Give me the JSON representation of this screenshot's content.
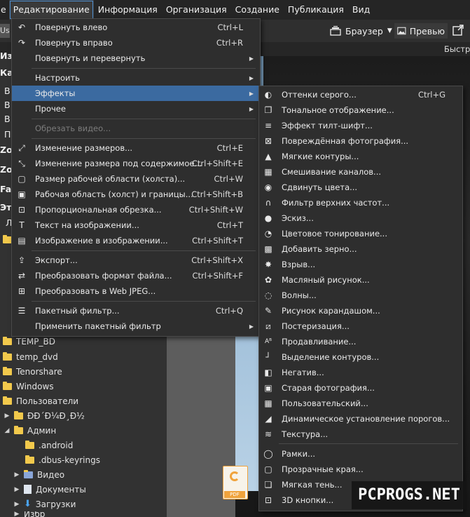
{
  "menubar": {
    "items": [
      {
        "label": "е"
      },
      {
        "label": "Редактирование"
      },
      {
        "label": "Информация"
      },
      {
        "label": "Организация"
      },
      {
        "label": "Создание"
      },
      {
        "label": "Публикация"
      },
      {
        "label": "Вид"
      }
    ]
  },
  "toolbar": {
    "user_tab": "Use",
    "browser_label": "Браузер",
    "preview_label": "Превью",
    "fast_label": "Быстр"
  },
  "sidebar": {
    "fragments": [
      "Из",
      "Ка",
      "В",
      "В",
      "В",
      "П",
      "Zo",
      "Zo",
      "Fac",
      "Эт",
      "Л"
    ],
    "items": [
      {
        "label": "TEMP_BD"
      },
      {
        "label": "temp_dvd"
      },
      {
        "label": "Tenorshare"
      },
      {
        "label": "Windows"
      },
      {
        "label": "Пользователи"
      },
      {
        "label": "ÐÐ´Ð¼Ð¸Ð½"
      },
      {
        "label": "Админ"
      },
      {
        "label": ".android"
      },
      {
        "label": ".dbus-keyrings"
      },
      {
        "label": "Видео"
      },
      {
        "label": "Документы"
      },
      {
        "label": "Загрузки"
      },
      {
        "label": "Избр"
      }
    ]
  },
  "edit_menu": {
    "items": [
      {
        "label": "Повернуть влево",
        "shortcut": "Ctrl+L",
        "icon": "rotate-left-icon"
      },
      {
        "label": "Повернуть вправо",
        "shortcut": "Ctrl+R",
        "icon": "rotate-right-icon"
      },
      {
        "label": "Повернуть и перевернуть",
        "shortcut": "",
        "submenu": true
      },
      {
        "label": "Настроить",
        "shortcut": "",
        "submenu": true
      },
      {
        "label": "Эффекты",
        "shortcut": "",
        "submenu": true,
        "highlighted": true
      },
      {
        "label": "Прочее",
        "shortcut": "",
        "submenu": true
      },
      {
        "label": "Обрезать видео...",
        "shortcut": "",
        "disabled": true
      },
      {
        "label": "Изменение размеров...",
        "shortcut": "Ctrl+E",
        "icon": "resize-icon"
      },
      {
        "label": "Изменение размера под содержимое...",
        "shortcut": "Ctrl+Shift+E",
        "icon": "content-resize-icon"
      },
      {
        "label": "Размер рабочей области (холста)...",
        "shortcut": "Ctrl+W",
        "icon": "canvas-size-icon"
      },
      {
        "label": "Рабочая область (холст) и границы...",
        "shortcut": "Ctrl+Shift+B",
        "icon": "canvas-border-icon"
      },
      {
        "label": "Пропорциональная обрезка...",
        "shortcut": "Ctrl+Shift+W",
        "icon": "crop-icon"
      },
      {
        "label": "Текст на изображении...",
        "shortcut": "Ctrl+T",
        "icon": "text-icon"
      },
      {
        "label": "Изображение в изображении...",
        "shortcut": "Ctrl+Shift+T",
        "icon": "image-in-image-icon"
      },
      {
        "label": "Экспорт...",
        "shortcut": "Ctrl+Shift+X",
        "icon": "export-icon"
      },
      {
        "label": "Преобразовать формат файла...",
        "shortcut": "Ctrl+Shift+F",
        "icon": "convert-icon"
      },
      {
        "label": "Преобразовать в Web JPEG...",
        "shortcut": "",
        "icon": "web-jpeg-icon"
      },
      {
        "label": "Пакетный фильтр...",
        "shortcut": "Ctrl+Q",
        "icon": "batch-filter-icon"
      },
      {
        "label": "Применить пакетный фильтр",
        "shortcut": "",
        "submenu": true
      }
    ]
  },
  "effects_menu": {
    "items": [
      {
        "label": "Оттенки серого...",
        "shortcut": "Ctrl+G",
        "icon": "grayscale-icon"
      },
      {
        "label": "Тональное отображение...",
        "shortcut": "",
        "icon": "tone-mapping-icon"
      },
      {
        "label": "Эффект тилт-шифт...",
        "shortcut": "",
        "icon": "tilt-shift-icon"
      },
      {
        "label": "Повреждённая фотография...",
        "shortcut": "",
        "icon": "damaged-photo-icon"
      },
      {
        "label": "Мягкие контуры...",
        "shortcut": "",
        "icon": "soft-edges-icon"
      },
      {
        "label": "Смешивание каналов...",
        "shortcut": "",
        "icon": "channel-mixer-icon"
      },
      {
        "label": "Сдвинуть цвета...",
        "shortcut": "",
        "icon": "color-shift-icon"
      },
      {
        "label": "Фильтр верхних частот...",
        "shortcut": "",
        "icon": "high-pass-icon"
      },
      {
        "label": "Эскиз...",
        "shortcut": "",
        "icon": "sketch-icon"
      },
      {
        "label": "Цветовое тонирование...",
        "shortcut": "",
        "icon": "color-tone-icon"
      },
      {
        "label": "Добавить зерно...",
        "shortcut": "",
        "icon": "grain-icon"
      },
      {
        "label": "Взрыв...",
        "shortcut": "",
        "icon": "explode-icon"
      },
      {
        "label": "Масляный рисунок...",
        "shortcut": "",
        "icon": "oil-paint-icon"
      },
      {
        "label": "Волны...",
        "shortcut": "",
        "icon": "waves-icon"
      },
      {
        "label": "Рисунок карандашом...",
        "shortcut": "",
        "icon": "pencil-icon"
      },
      {
        "label": "Постеризация...",
        "shortcut": "",
        "icon": "posterize-icon"
      },
      {
        "label": "Продавливание...",
        "shortcut": "",
        "icon": "emboss-icon"
      },
      {
        "label": "Выделение контуров...",
        "shortcut": "",
        "icon": "edge-detect-icon"
      },
      {
        "label": "Негатив...",
        "shortcut": "",
        "icon": "negative-icon"
      },
      {
        "label": "Старая фотография...",
        "shortcut": "",
        "icon": "old-photo-icon"
      },
      {
        "label": "Пользовательский...",
        "shortcut": "",
        "icon": "custom-filter-icon"
      },
      {
        "label": "Динамическое установление порогов...",
        "shortcut": "",
        "icon": "threshold-icon"
      },
      {
        "label": "Текстура...",
        "shortcut": "",
        "icon": "texture-icon"
      },
      {
        "label": "Рамки...",
        "shortcut": "",
        "icon": "frames-icon"
      },
      {
        "label": "Прозрачные края...",
        "shortcut": "",
        "icon": "transparent-edges-icon"
      },
      {
        "label": "Мягкая тень...",
        "shortcut": "",
        "icon": "soft-shadow-icon"
      },
      {
        "label": "3D кнопки...",
        "shortcut": "",
        "icon": "3d-buttons-icon"
      }
    ]
  },
  "pdf_badge": "PDF",
  "watermark": "PCPROGS.NET",
  "colors": {
    "highlight": "#3b6aa0",
    "menu_bg": "#2e2e2e",
    "folder": "#f2c94c"
  }
}
